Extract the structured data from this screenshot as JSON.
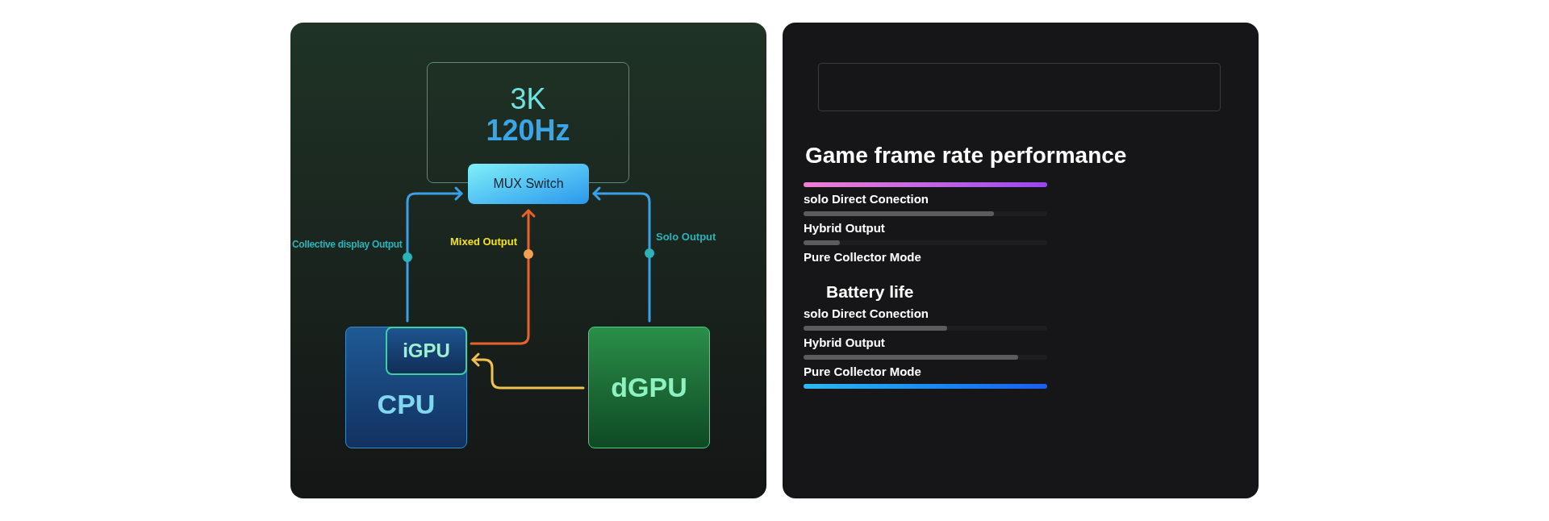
{
  "diagram": {
    "display": {
      "resolution": "3K",
      "refresh": "120Hz"
    },
    "switch": "MUX Switch",
    "outputs": [
      {
        "label": "Collective display Output",
        "color": "#2bb3b8"
      },
      {
        "label": "Mixed Output",
        "color": "#f2e21c"
      },
      {
        "label": "Solo Output",
        "color": "#2bb3b8"
      }
    ],
    "chips": {
      "cpu": "CPU",
      "igpu": "iGPU",
      "dgpu": "dGPU"
    }
  },
  "performance": {
    "title": "Game frame rate performance",
    "rows": [
      {
        "kind": "pink-bar",
        "level": 1
      },
      {
        "kind": "label",
        "text": "solo Direct Conection"
      },
      {
        "kind": "bar",
        "level": 0.78,
        "color": "#5c5c5c"
      },
      {
        "kind": "label",
        "text": "Hybrid Output"
      },
      {
        "kind": "bar",
        "level": 0.15,
        "color": "#5c5c5c"
      },
      {
        "kind": "label",
        "text": "Pure Collector Mode"
      }
    ]
  },
  "battery": {
    "title": "Battery life",
    "rows": [
      {
        "kind": "label",
        "text": "solo Direct Conection"
      },
      {
        "kind": "bar",
        "level": 0.59,
        "color": "#5c5c5c"
      },
      {
        "kind": "label",
        "text": "Hybrid Output"
      },
      {
        "kind": "bar",
        "level": 0.88,
        "color": "#5c5c5c"
      },
      {
        "kind": "label",
        "text": "Pure Collector Mode"
      },
      {
        "kind": "blue-bar",
        "level": 1
      }
    ]
  }
}
